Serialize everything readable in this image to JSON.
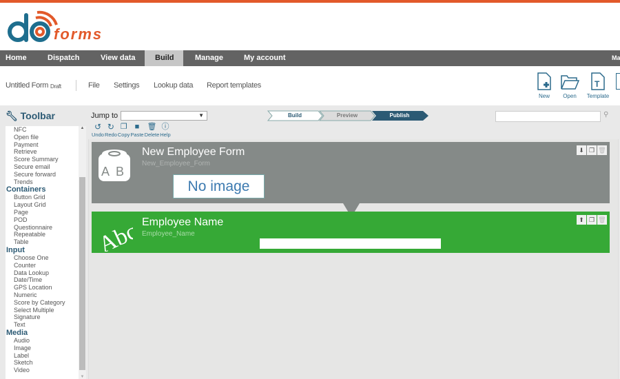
{
  "brand": {
    "logo_text": "doforms",
    "accent": "#e2592a",
    "primary": "#2c5a74"
  },
  "nav": {
    "items": [
      {
        "label": "Home"
      },
      {
        "label": "Dispatch"
      },
      {
        "label": "View data"
      },
      {
        "label": "Build",
        "active": true
      },
      {
        "label": "Manage"
      },
      {
        "label": "My account"
      }
    ],
    "user": "Mar"
  },
  "subbar": {
    "form_title": "Untitled Form",
    "status": "Draft",
    "menu": [
      "File",
      "Settings",
      "Lookup data",
      "Report templates"
    ],
    "actions": [
      {
        "label": "New",
        "icon": "new-file-icon"
      },
      {
        "label": "Open",
        "icon": "folder-open-icon"
      },
      {
        "label": "Template",
        "icon": "template-icon"
      }
    ]
  },
  "toolbar": {
    "title": "Toolbar",
    "jump_to_label": "Jump to",
    "jump_to_value": "",
    "tools": [
      "Undo",
      "Redo",
      "Copy",
      "Paste",
      "Delete",
      "Help"
    ]
  },
  "steps": [
    "Build",
    "Preview",
    "Publish"
  ],
  "search": {
    "value": ""
  },
  "palette": [
    {
      "items": [
        "NFC",
        "Open file",
        "Payment",
        "Retrieve",
        "Score Summary",
        "Secure email",
        "Secure forward",
        "Trends"
      ]
    },
    {
      "header": "Containers",
      "items": [
        "Button Grid",
        "Layout Grid",
        "Page",
        "POD",
        "Questionnaire",
        "Repeatable",
        "Table"
      ]
    },
    {
      "header": "Input",
      "items": [
        "Choose One",
        "Counter",
        "Data Lookup",
        "Date/Time",
        "GPS Location",
        "Numeric",
        "Score by Category",
        "Select Multiple",
        "Signature",
        "Text"
      ]
    },
    {
      "header": "Media",
      "items": [
        "Audio",
        "Image",
        "Label",
        "Sketch",
        "Video"
      ]
    }
  ],
  "form": {
    "title": "New Employee Form",
    "name": "New_Employee_Form",
    "image_placeholder": "No image",
    "color": "#858a88"
  },
  "field": {
    "title": "Employee Name",
    "name": "Employee_Name",
    "value": "",
    "color": "#36a936"
  }
}
